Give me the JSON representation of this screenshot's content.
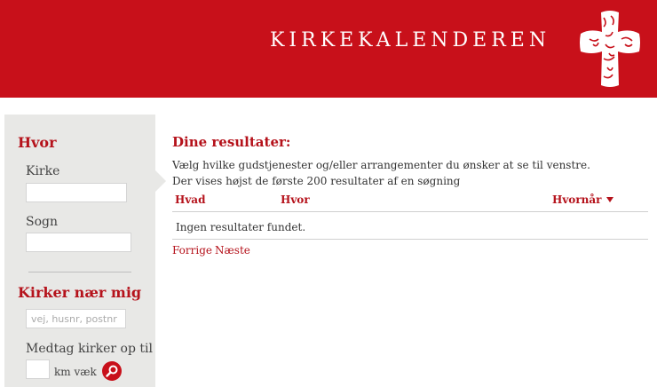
{
  "header": {
    "site_title": "KIRKEKALENDEREN",
    "brand_color": "#c8101a"
  },
  "sidebar": {
    "where": {
      "heading": "Hvor",
      "church_label": "Kirke",
      "church_value": "",
      "parish_label": "Sogn",
      "parish_value": ""
    },
    "nearby": {
      "heading": "Kirker nær mig",
      "address_placeholder": "vej, husnr, postnr",
      "include_label": "Medtag kirker op til",
      "km_value": "",
      "km_suffix": "km væk"
    }
  },
  "main": {
    "title": "Dine resultater:",
    "intro_line1": "Vælg hvilke gudstjenester og/eller arrangementer du ønsker at se til venstre.",
    "intro_line2": "Der vises højst de første 200 resultater af en søgning",
    "columns": {
      "what": "Hvad",
      "where": "Hvor",
      "when": "Hvornår"
    },
    "no_results": "Ingen resultater fundet.",
    "pager": {
      "prev": "Forrige",
      "next": "Næste"
    }
  }
}
